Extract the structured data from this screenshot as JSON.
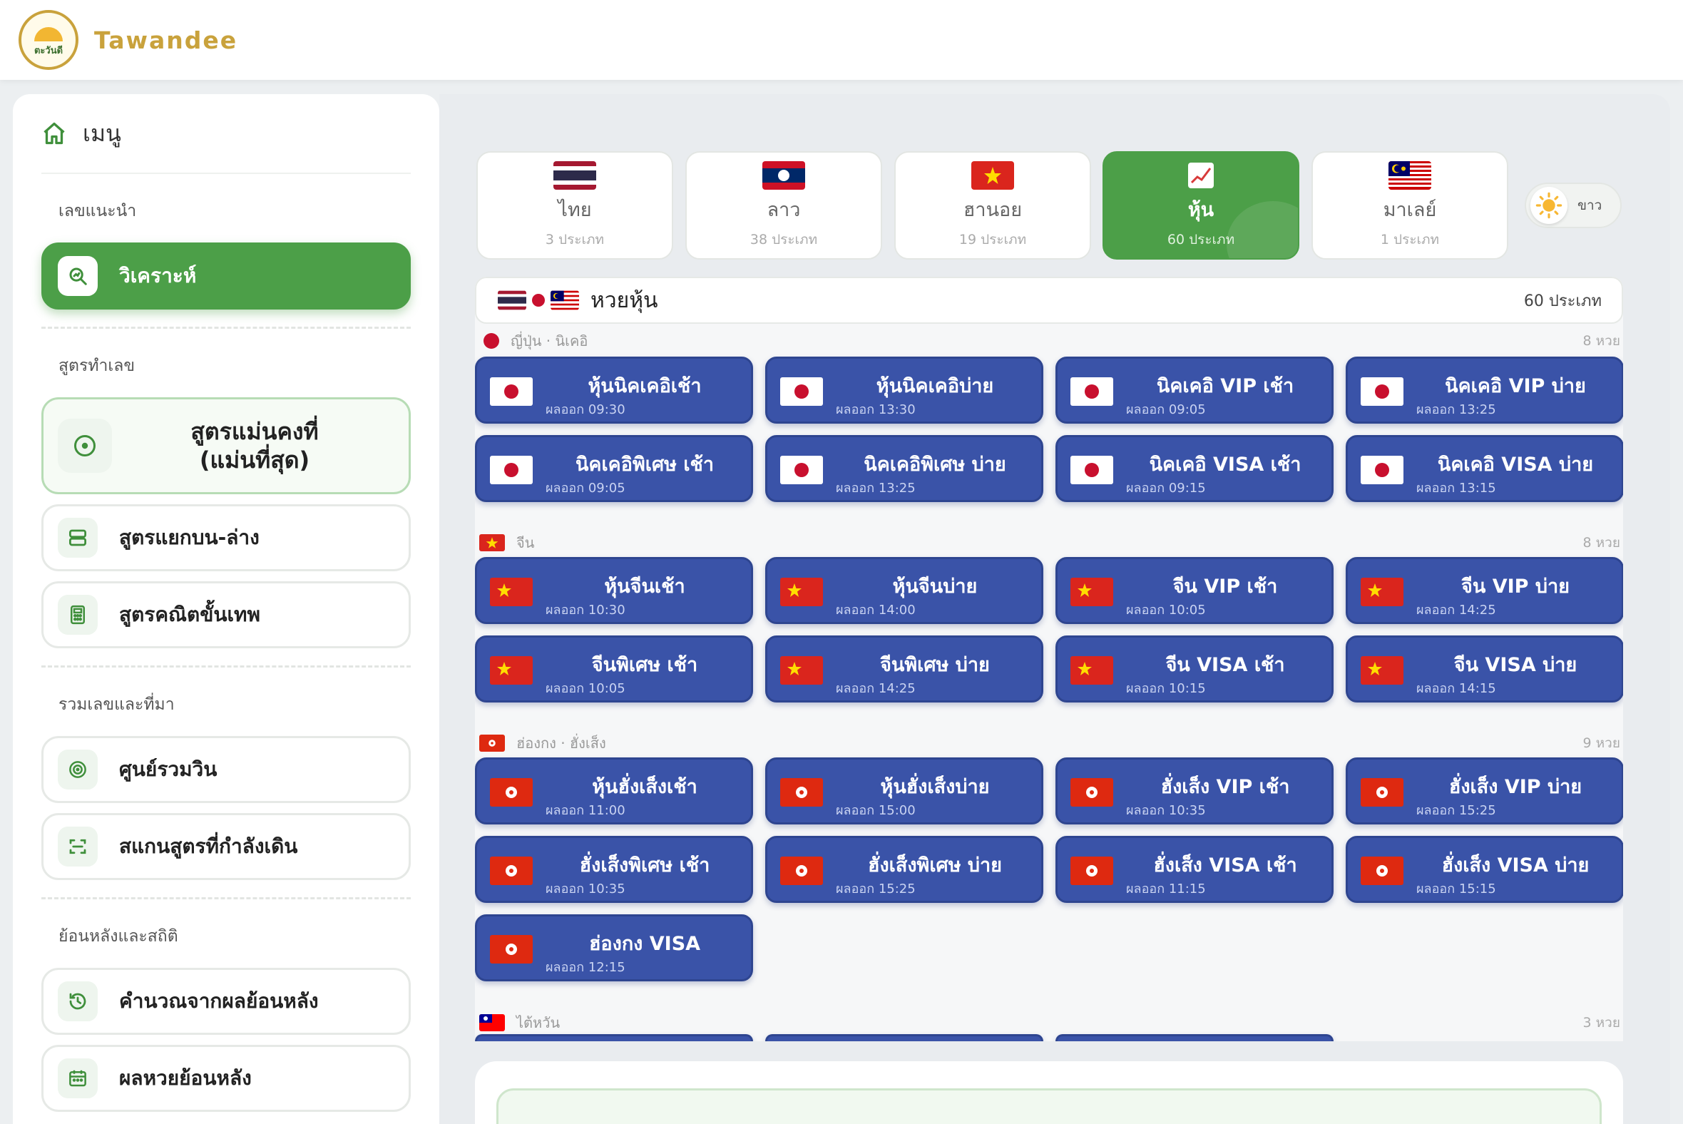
{
  "brand": {
    "name": "Tawandee",
    "logo_text": "ตะวันดี"
  },
  "sidebar": {
    "menu_title": "เมนู",
    "sections": [
      {
        "label": "เลขแนะนำ"
      },
      {
        "label": "สูตรทำเลข"
      },
      {
        "label": "รวมเลขและที่มา"
      },
      {
        "label": "ย้อนหลังและสถิติ"
      }
    ],
    "items": [
      {
        "label": "วิเคราะห์",
        "icon": "search-chart-icon"
      },
      {
        "label": "สูตรแม่นคงที่\n(แม่นที่สุด)",
        "icon": "target-icon"
      },
      {
        "label": "สูตรแยกบน-ล่าง",
        "icon": "split-rows-icon"
      },
      {
        "label": "สูตรคณิตขั้นเทพ",
        "icon": "calculator-icon"
      },
      {
        "label": "ศูนย์รวมวิน",
        "icon": "bullseye-icon"
      },
      {
        "label": "สแกนสูตรที่กำลังเดิน",
        "icon": "scan-icon"
      },
      {
        "label": "คำนวณจากผลย้อนหลัง",
        "icon": "history-icon"
      },
      {
        "label": "ผลหวยย้อนหลัง",
        "icon": "calendar-icon"
      }
    ]
  },
  "tabs": [
    {
      "name": "ไทย",
      "count": "3 ประเภท",
      "flag": "th"
    },
    {
      "name": "ลาว",
      "count": "38 ประเภท",
      "flag": "la"
    },
    {
      "name": "ฮานอย",
      "count": "19 ประเภท",
      "flag": "vn"
    },
    {
      "name": "หุ้น",
      "count": "60 ประเภท",
      "flag": "chart",
      "active": true
    },
    {
      "name": "มาเลย์",
      "count": "1 ประเภท",
      "flag": "my"
    }
  ],
  "theme_toggle": {
    "label": "ขาว"
  },
  "panel": {
    "title": "หวยหุ้น",
    "count": "60 ประเภท",
    "groups": [
      {
        "name": "ญี่ปุ่น · นิเคอิ",
        "count": "8 หวย",
        "flag": "jp",
        "cards": [
          {
            "name": "หุ้นนิคเคอิเช้า",
            "result": "ผลออก 09:30"
          },
          {
            "name": "หุ้นนิคเคอิบ่าย",
            "result": "ผลออก 13:30"
          },
          {
            "name": "นิคเคอิ VIP เช้า",
            "result": "ผลออก 09:05"
          },
          {
            "name": "นิคเคอิ VIP บ่าย",
            "result": "ผลออก 13:25"
          },
          {
            "name": "นิคเคอิพิเศษ เช้า",
            "result": "ผลออก 09:05"
          },
          {
            "name": "นิคเคอิพิเศษ บ่าย",
            "result": "ผลออก 13:25"
          },
          {
            "name": "นิคเคอิ VISA เช้า",
            "result": "ผลออก 09:15"
          },
          {
            "name": "นิคเคอิ VISA บ่าย",
            "result": "ผลออก 13:15"
          }
        ]
      },
      {
        "name": "จีน",
        "count": "8 หวย",
        "flag": "cn",
        "cards": [
          {
            "name": "หุ้นจีนเช้า",
            "result": "ผลออก 10:30"
          },
          {
            "name": "หุ้นจีนบ่าย",
            "result": "ผลออก 14:00"
          },
          {
            "name": "จีน VIP เช้า",
            "result": "ผลออก 10:05"
          },
          {
            "name": "จีน VIP บ่าย",
            "result": "ผลออก 14:25"
          },
          {
            "name": "จีนพิเศษ เช้า",
            "result": "ผลออก 10:05"
          },
          {
            "name": "จีนพิเศษ บ่าย",
            "result": "ผลออก 14:25"
          },
          {
            "name": "จีน VISA เช้า",
            "result": "ผลออก 10:15"
          },
          {
            "name": "จีน VISA บ่าย",
            "result": "ผลออก 14:15"
          }
        ]
      },
      {
        "name": "ฮ่องกง · ฮั่งเส็ง",
        "count": "9 หวย",
        "flag": "hk",
        "cards": [
          {
            "name": "หุ้นฮั่งเส็งเช้า",
            "result": "ผลออก 11:00"
          },
          {
            "name": "หุ้นฮั่งเส็งบ่าย",
            "result": "ผลออก 15:00"
          },
          {
            "name": "ฮั่งเส็ง VIP เช้า",
            "result": "ผลออก 10:35"
          },
          {
            "name": "ฮั่งเส็ง VIP บ่าย",
            "result": "ผลออก 15:25"
          },
          {
            "name": "ฮั่งเส็งพิเศษ เช้า",
            "result": "ผลออก 10:35"
          },
          {
            "name": "ฮั่งเส็งพิเศษ บ่าย",
            "result": "ผลออก 15:25"
          },
          {
            "name": "ฮั่งเส็ง VISA เช้า",
            "result": "ผลออก 11:15"
          },
          {
            "name": "ฮั่งเส็ง VISA บ่าย",
            "result": "ผลออก 15:15"
          },
          {
            "name": "ฮ่องกง VISA",
            "result": "ผลออก 12:15"
          }
        ]
      },
      {
        "name": "ไต้หวัน",
        "count": "3 หวย",
        "flag": "tw",
        "cards": []
      }
    ]
  },
  "colors": {
    "accent_green": "#4c9f48",
    "card_blue": "#3a53a8",
    "brand_gold": "#c9a23c"
  }
}
